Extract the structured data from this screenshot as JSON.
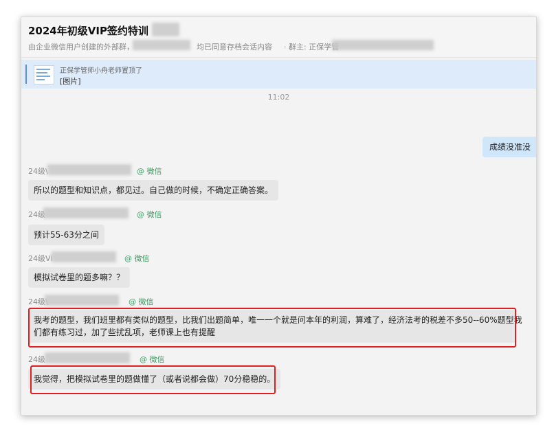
{
  "header": {
    "title": "2024年初级VIP签约特训",
    "subtitle_prefix": "由企业微信用户创建的外部群，",
    "subtitle_mid": "均已同意存档会话内容",
    "subtitle_owner": "· 群主: 正保学管"
  },
  "pinned": {
    "notice": "正保学管师小舟老师置顶了",
    "content": "[图片]"
  },
  "time_divider": "11:02",
  "outgoing_message": "成绩没准没",
  "messages": [
    {
      "sender": "24级\\",
      "source": "@ 微信",
      "text": "所以的题型和知识点，都见过。自己做的时候，不确定正确答案。"
    },
    {
      "sender": "24级",
      "source": "@ 微信",
      "text": "预计55-63分之间"
    },
    {
      "sender": "24级VI",
      "source": "@ 微信",
      "text": "模拟试卷里的题多嘛？？"
    },
    {
      "sender": "24级\\",
      "source": "@ 微信",
      "text_line1": "我考的题型，我们班里都有类似的题型，比我们出题简单，唯一一个就是问本年的利润，算难了，经济法考的税差不多50--60%题型我",
      "text_line2": "们都有练习过，加了些扰乱项，老师课上也有提醒"
    },
    {
      "sender": "24级",
      "source": "@ 微信",
      "text": "我觉得，把模拟试卷里的题做懂了（或者说都会做）70分稳稳的。"
    }
  ],
  "colors": {
    "highlight_box": "#e02020",
    "pinned_bg": "#deebfa",
    "outgoing_bubble": "#cfe6fb",
    "incoming_bubble": "#e6e6e6",
    "wechat_source": "#3c9a62"
  }
}
